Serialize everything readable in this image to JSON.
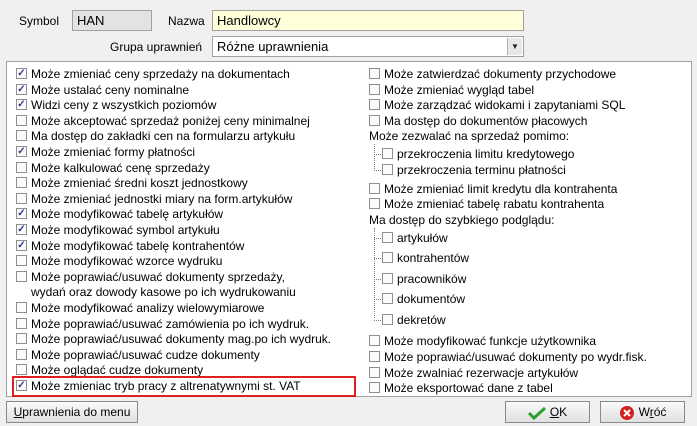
{
  "header": {
    "symbol_label": "Symbol",
    "symbol_value": "HAN",
    "name_label": "Nazwa",
    "name_value": "Handlowcy",
    "group_label": "Grupa uprawnień",
    "group_value": "Różne uprawnienia"
  },
  "left_items": [
    {
      "label": "Może zmieniać ceny sprzedaży na dokumentach",
      "checked": true
    },
    {
      "label": "Może ustalać ceny nominalne",
      "checked": true
    },
    {
      "label": "Widzi ceny z wszystkich poziomów",
      "checked": true
    },
    {
      "label": "Może akceptować sprzedaż poniżej ceny minimalnej",
      "checked": false
    },
    {
      "label": "Ma dostęp do zakładki cen na formularzu artykułu",
      "checked": false
    },
    {
      "label": "Może zmieniać formy płatności",
      "checked": true
    },
    {
      "label": "Może kalkulować cenę sprzedaży",
      "checked": false
    },
    {
      "label": "Może zmieniać średni koszt jednostkowy",
      "checked": false
    },
    {
      "label": "Może zmieniać jednostki miary na form.artykułów",
      "checked": false
    },
    {
      "label": "Może modyfikować tabelę artykułów",
      "checked": true
    },
    {
      "label": "Może modyfikować symbol artykułu",
      "checked": true
    },
    {
      "label": "Może modyfikować tabelę kontrahentów",
      "checked": true
    },
    {
      "label": "Może modyfikować wzorce wydruku",
      "checked": false
    },
    {
      "label": "Może poprawiać/usuwać dokumenty sprzedaży,",
      "label2": "wydań oraz dowody kasowe po ich wydrukowaniu",
      "checked": false
    },
    {
      "label": "Może modyfikować analizy wielowymiarowe",
      "checked": false
    },
    {
      "label": "Może poprawiać/usuwać zamówienia po ich wydruk.",
      "checked": false
    },
    {
      "label": "Może poprawiać/usuwać dokumenty mag.po ich wydruk.",
      "checked": false
    },
    {
      "label": "Może poprawiać/usuwać cudze dokumenty",
      "checked": false
    },
    {
      "label": "Może oglądać cudze dokumenty",
      "checked": false
    },
    {
      "label": "Może zmieniac tryb pracy z altrenatywnymi st. VAT",
      "checked": true
    }
  ],
  "right_top": [
    {
      "label": "Może zatwierdzać dokumenty przychodowe",
      "checked": false
    },
    {
      "label": "Może zmieniać wygląd tabel",
      "checked": false
    },
    {
      "label": "Może zarządzać widokami i zapytaniami SQL",
      "checked": false
    },
    {
      "label": "Ma dostęp do dokumentów płacowych",
      "checked": false
    }
  ],
  "sale_section_label": "Może zezwalać na sprzedaż pomimo:",
  "sale_items": [
    {
      "label": "przekroczenia limitu kredytowego",
      "checked": false
    },
    {
      "label": "przekroczenia terminu płatności",
      "checked": false
    }
  ],
  "right_mid": [
    {
      "label": "Może zmieniać limit kredytu dla kontrahenta",
      "checked": false
    },
    {
      "label": "Może zmieniać tabelę rabatu kontrahenta",
      "checked": false
    }
  ],
  "preview_section_label": "Ma dostęp do szybkiego podglądu:",
  "preview_items": [
    {
      "label": "artykułów",
      "checked": false
    },
    {
      "label": "kontrahentów",
      "checked": false
    },
    {
      "label": "pracowników",
      "checked": false
    },
    {
      "label": "dokumentów",
      "checked": false
    },
    {
      "label": "dekretów",
      "checked": false
    }
  ],
  "right_bottom": [
    {
      "label": "Może modyfikować funkcje użytkownika",
      "checked": false
    },
    {
      "label": "Może poprawiać/usuwać dokumenty po wydr.fisk.",
      "checked": false
    },
    {
      "label": "Może zwalniać rezerwacje artykułów",
      "checked": false
    },
    {
      "label": "Może eksportować dane z tabel",
      "checked": false
    }
  ],
  "buttons": {
    "menu_rights_u": "U",
    "menu_rights_rest": "prawnienia do menu",
    "ok_u": "O",
    "ok_rest": "K",
    "back_pre": "W",
    "back_u": "r",
    "back_rest": "óć"
  },
  "colors": {
    "highlight": "#e02020",
    "ok_icon": "#2e9e2e",
    "back_icon": "#d02020"
  }
}
